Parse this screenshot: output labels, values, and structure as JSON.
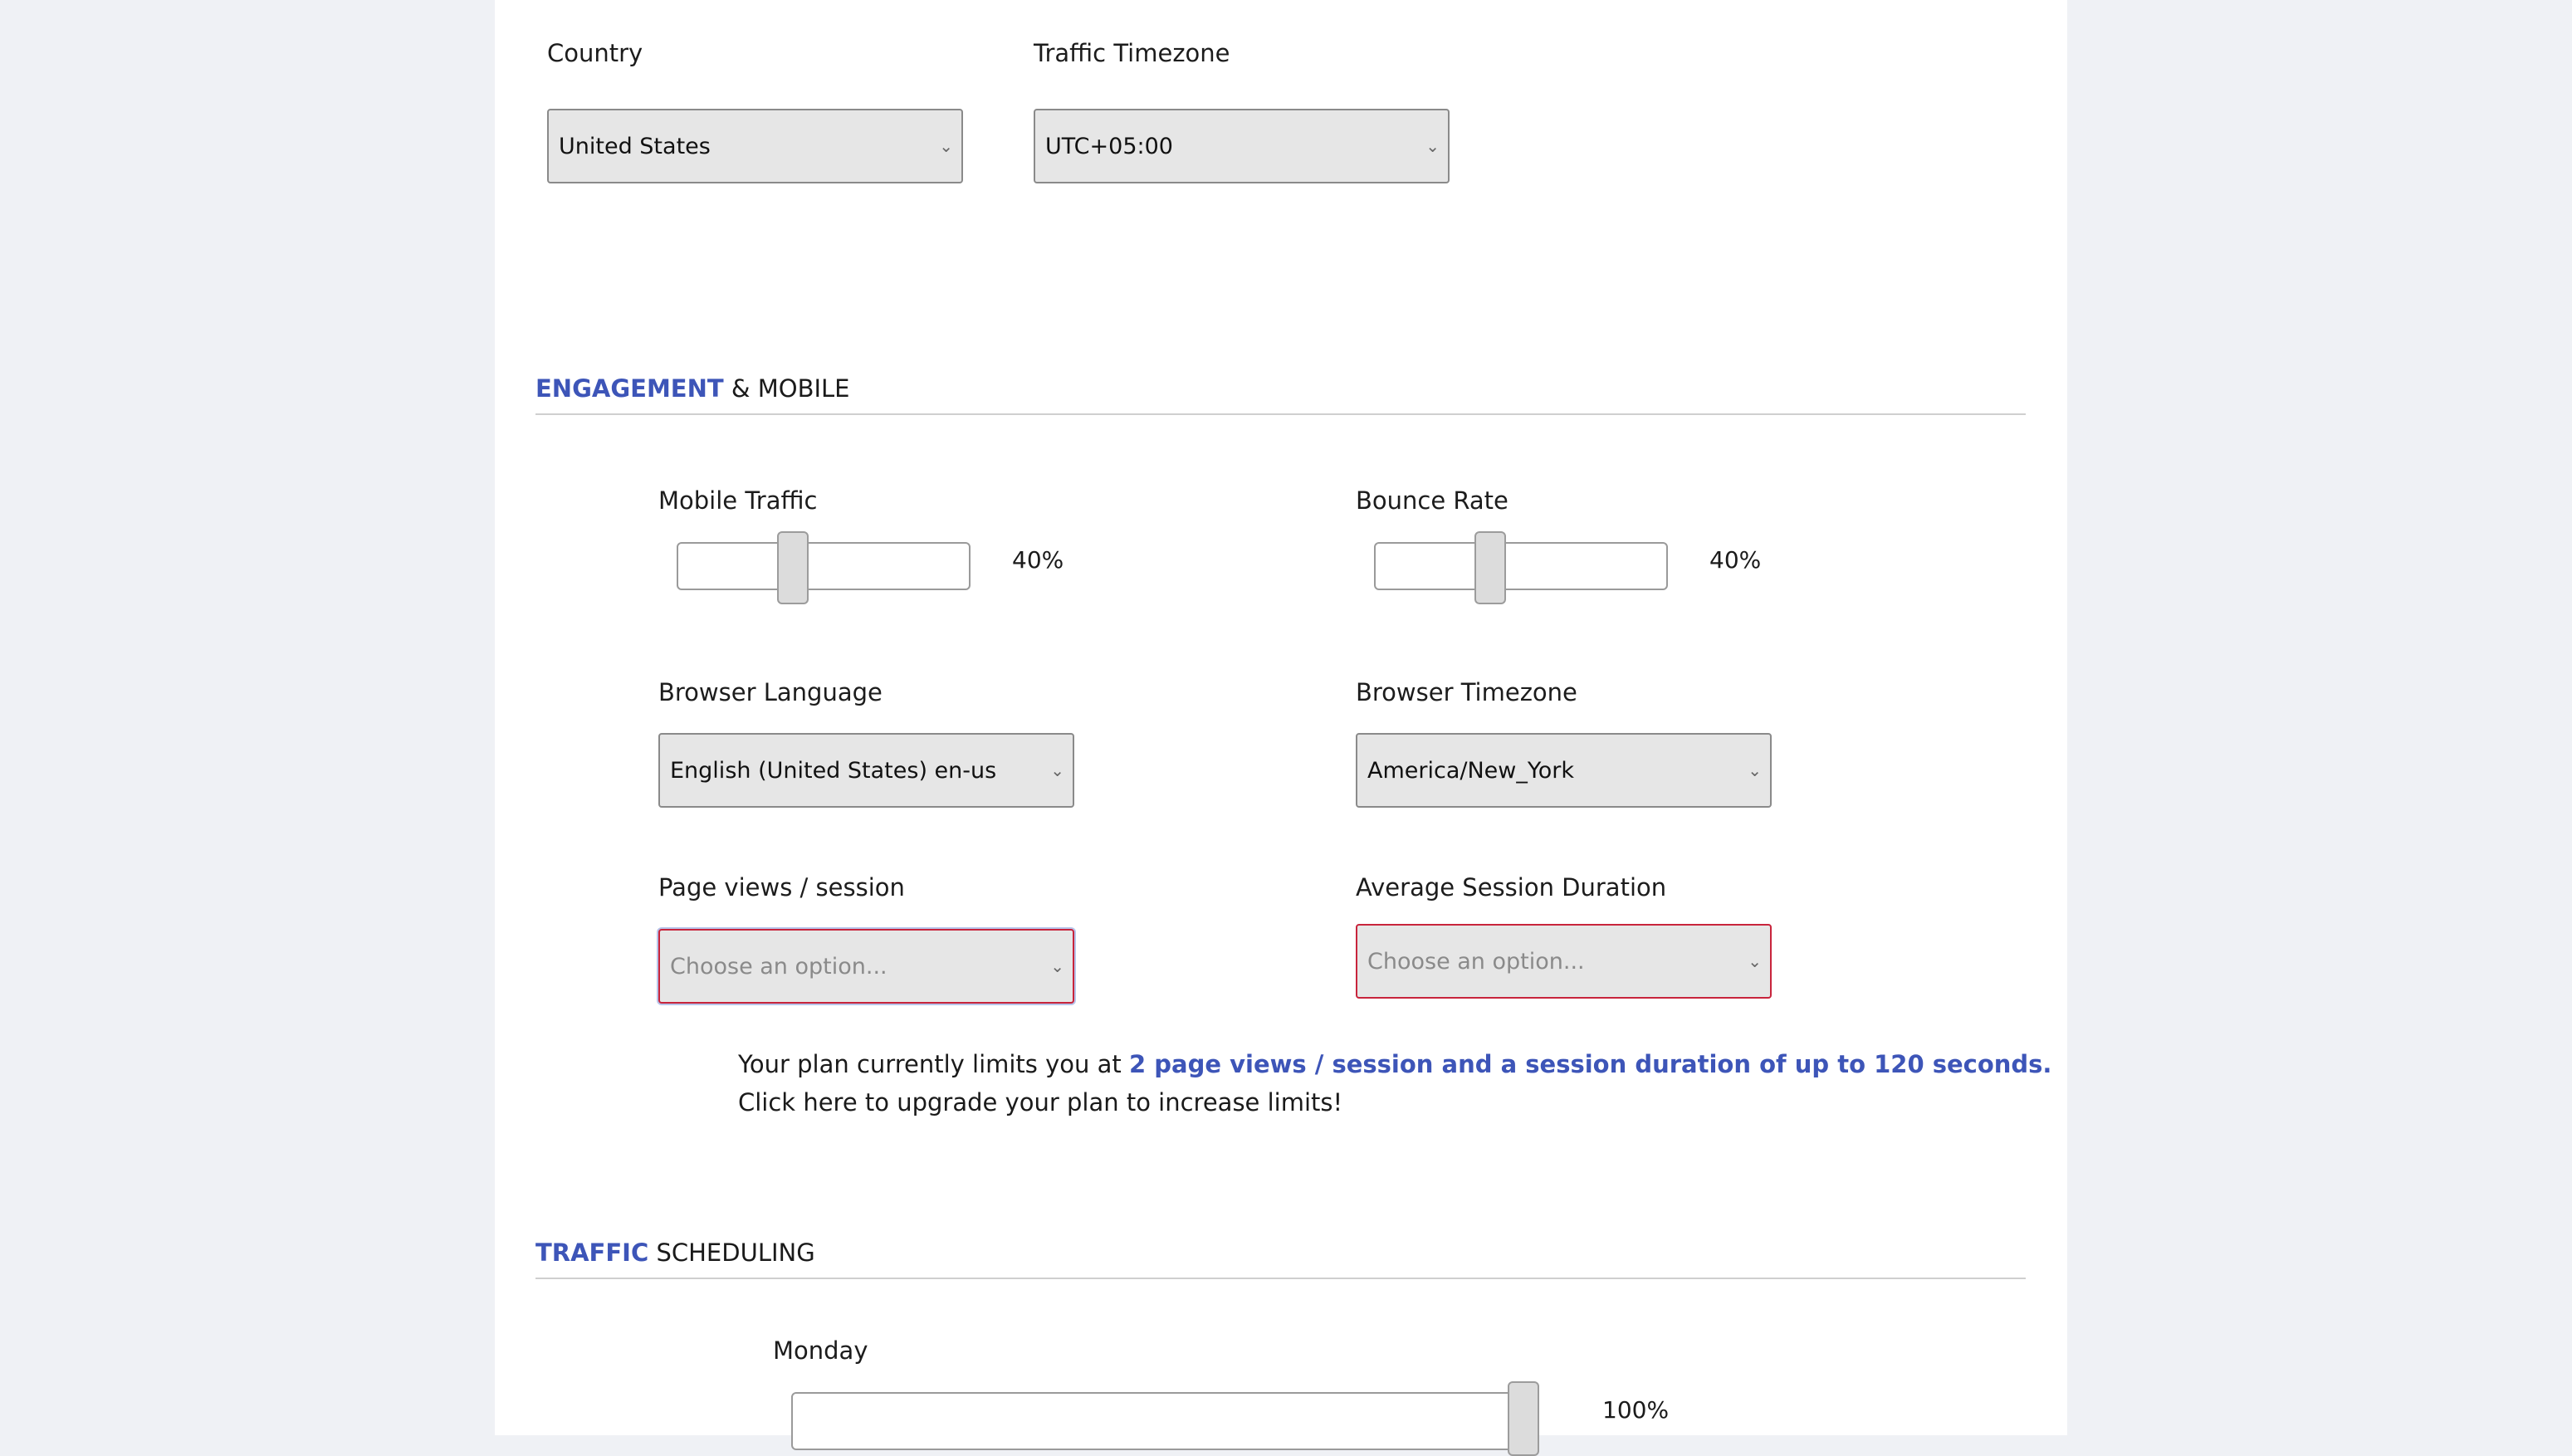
{
  "geo": {
    "country_label": "Country",
    "country_value": "United States",
    "timezone_label": "Traffic Timezone",
    "timezone_value": "UTC+05:00"
  },
  "engagement": {
    "heading_accent": "ENGAGEMENT",
    "heading_rest": "& MOBILE",
    "mobile_label": "Mobile Traffic",
    "mobile_value": "40%",
    "mobile_level": 0.4,
    "bounce_label": "Bounce Rate",
    "bounce_value": "40%",
    "bounce_level": 0.4,
    "browser_lang_label": "Browser Language",
    "browser_lang_value": "English (United States) en-us",
    "browser_tz_label": "Browser Timezone",
    "browser_tz_value": "America/New_York",
    "pageviews_label": "Page views / session",
    "pageviews_placeholder": "Choose an option...",
    "duration_label": "Average Session Duration",
    "duration_placeholder": "Choose an option...",
    "notice_prefix": "Your plan currently limits you at ",
    "notice_highlight": "2 page views / session and a session duration of up to 120 seconds.",
    "notice_line2": "Click here to upgrade your plan to increase limits!"
  },
  "scheduling": {
    "heading_accent": "TRAFFIC",
    "heading_rest": "SCHEDULING",
    "monday_label": "Monday",
    "monday_value": "100%",
    "monday_level": 1.0
  },
  "colors": {
    "accent": "#3d55b8",
    "invalid_border": "#c8243c",
    "page_bg": "#eff1f5"
  },
  "icons": {
    "select_chevron": "chevron-down-icon"
  }
}
